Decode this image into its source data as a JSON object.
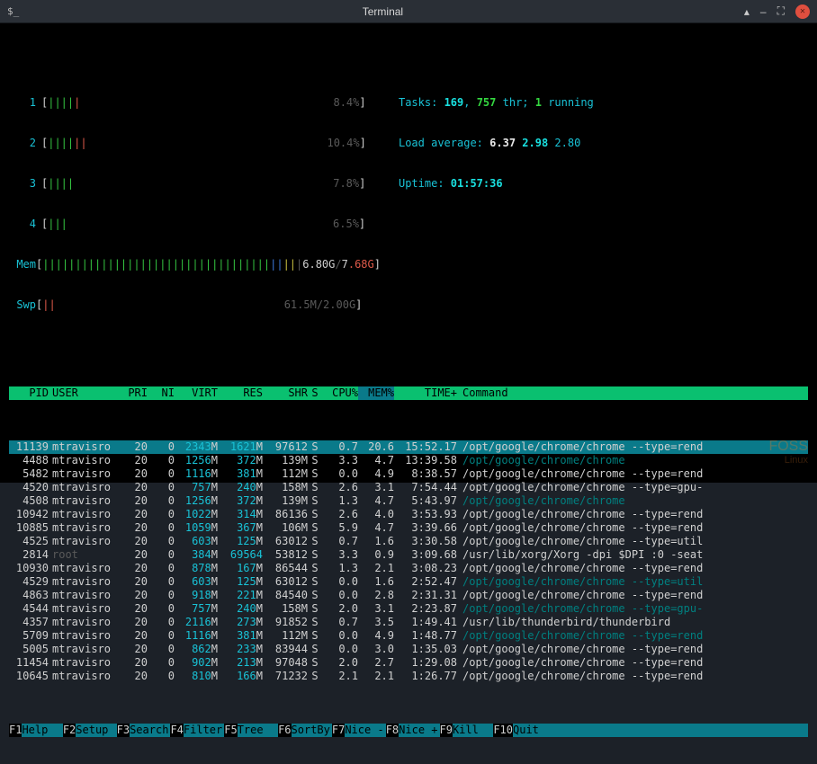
{
  "titlebar": {
    "app_glyph": "$_",
    "title": "Terminal"
  },
  "cpus": [
    {
      "id": "1",
      "pct": "8.4%"
    },
    {
      "id": "2",
      "pct": "10.4%"
    },
    {
      "id": "3",
      "pct": "7.8%"
    },
    {
      "id": "4",
      "pct": "6.5%"
    }
  ],
  "mem": {
    "label": "Mem",
    "used": "6.80G",
    "sep": "/",
    "total_a": "7",
    "total_b": ".68G"
  },
  "swp": {
    "label": "Swp",
    "used": "61.5M",
    "total": "2.00G"
  },
  "tasks": {
    "label": "Tasks: ",
    "procs": "169",
    "sep1": ", ",
    "threads": "757",
    "thr_lbl": " thr; ",
    "running": "1",
    "run_lbl": " running"
  },
  "loadavg": {
    "label": "Load average: ",
    "a": "6.37",
    "b": "2.98",
    "c": "2.80"
  },
  "uptime": {
    "label": "Uptime: ",
    "value": "01:57:36"
  },
  "columns": {
    "pid": "PID",
    "user": "USER",
    "pri": "PRI",
    "ni": "NI",
    "virt": "VIRT",
    "res": "RES",
    "shr": "SHR",
    "s": "S",
    "cpu": "CPU%",
    "mem": "MEM%",
    "time": "TIME+",
    "cmd": "Command"
  },
  "rows": [
    {
      "pid": "11139",
      "user": "mtravisro",
      "pri": "20",
      "ni": "0",
      "virt": "2343M",
      "res": "1621M",
      "shr": "97612",
      "s": "S",
      "cpu": "0.7",
      "mem": "20.6",
      "time": "15:52.17",
      "cmd": "/opt/google/chrome/chrome --type=rend",
      "dim": false,
      "sel": true
    },
    {
      "pid": "4488",
      "user": "mtravisro",
      "pri": "20",
      "ni": "0",
      "virt": "1256M",
      "res": "372M",
      "shr": "139M",
      "s": "S",
      "cpu": "3.3",
      "mem": "4.7",
      "time": "13:39.58",
      "cmd": "/opt/google/chrome/chrome",
      "dim": true
    },
    {
      "pid": "5482",
      "user": "mtravisro",
      "pri": "20",
      "ni": "0",
      "virt": "1116M",
      "res": "381M",
      "shr": "112M",
      "s": "S",
      "cpu": "0.0",
      "mem": "4.9",
      "time": "8:38.57",
      "cmd": "/opt/google/chrome/chrome --type=rend",
      "dim": false
    },
    {
      "pid": "4520",
      "user": "mtravisro",
      "pri": "20",
      "ni": "0",
      "virt": "757M",
      "res": "240M",
      "shr": "158M",
      "s": "S",
      "cpu": "2.6",
      "mem": "3.1",
      "time": "7:54.44",
      "cmd": "/opt/google/chrome/chrome --type=gpu-",
      "dim": false
    },
    {
      "pid": "4508",
      "user": "mtravisro",
      "pri": "20",
      "ni": "0",
      "virt": "1256M",
      "res": "372M",
      "shr": "139M",
      "s": "S",
      "cpu": "1.3",
      "mem": "4.7",
      "time": "5:43.97",
      "cmd": "/opt/google/chrome/chrome",
      "dim": true
    },
    {
      "pid": "10942",
      "user": "mtravisro",
      "pri": "20",
      "ni": "0",
      "virt": "1022M",
      "res": "314M",
      "shr": "86136",
      "s": "S",
      "cpu": "2.6",
      "mem": "4.0",
      "time": "3:53.93",
      "cmd": "/opt/google/chrome/chrome --type=rend",
      "dim": false
    },
    {
      "pid": "10885",
      "user": "mtravisro",
      "pri": "20",
      "ni": "0",
      "virt": "1059M",
      "res": "367M",
      "shr": "106M",
      "s": "S",
      "cpu": "5.9",
      "mem": "4.7",
      "time": "3:39.66",
      "cmd": "/opt/google/chrome/chrome --type=rend",
      "dim": false
    },
    {
      "pid": "4525",
      "user": "mtravisro",
      "pri": "20",
      "ni": "0",
      "virt": "603M",
      "res": "125M",
      "shr": "63012",
      "s": "S",
      "cpu": "0.7",
      "mem": "1.6",
      "time": "3:30.58",
      "cmd": "/opt/google/chrome/chrome --type=util",
      "dim": false
    },
    {
      "pid": "2814",
      "user": "root",
      "pri": "20",
      "ni": "0",
      "virt": "384M",
      "res": "69564",
      "shr": "53812",
      "s": "S",
      "cpu": "3.3",
      "mem": "0.9",
      "time": "3:09.68",
      "cmd": "/usr/lib/xorg/Xorg -dpi $DPI :0 -seat",
      "dim": false,
      "userdim": true
    },
    {
      "pid": "10930",
      "user": "mtravisro",
      "pri": "20",
      "ni": "0",
      "virt": "878M",
      "res": "167M",
      "shr": "86544",
      "s": "S",
      "cpu": "1.3",
      "mem": "2.1",
      "time": "3:08.23",
      "cmd": "/opt/google/chrome/chrome --type=rend",
      "dim": false
    },
    {
      "pid": "4529",
      "user": "mtravisro",
      "pri": "20",
      "ni": "0",
      "virt": "603M",
      "res": "125M",
      "shr": "63012",
      "s": "S",
      "cpu": "0.0",
      "mem": "1.6",
      "time": "2:52.47",
      "cmd": "/opt/google/chrome/chrome --type=util",
      "dim": true
    },
    {
      "pid": "4863",
      "user": "mtravisro",
      "pri": "20",
      "ni": "0",
      "virt": "918M",
      "res": "221M",
      "shr": "84540",
      "s": "S",
      "cpu": "0.0",
      "mem": "2.8",
      "time": "2:31.31",
      "cmd": "/opt/google/chrome/chrome --type=rend",
      "dim": false
    },
    {
      "pid": "4544",
      "user": "mtravisro",
      "pri": "20",
      "ni": "0",
      "virt": "757M",
      "res": "240M",
      "shr": "158M",
      "s": "S",
      "cpu": "2.0",
      "mem": "3.1",
      "time": "2:23.87",
      "cmd": "/opt/google/chrome/chrome --type=gpu-",
      "dim": true
    },
    {
      "pid": "4357",
      "user": "mtravisro",
      "pri": "20",
      "ni": "0",
      "virt": "2116M",
      "res": "273M",
      "shr": "91852",
      "s": "S",
      "cpu": "0.7",
      "mem": "3.5",
      "time": "1:49.41",
      "cmd": "/usr/lib/thunderbird/thunderbird",
      "dim": false
    },
    {
      "pid": "5709",
      "user": "mtravisro",
      "pri": "20",
      "ni": "0",
      "virt": "1116M",
      "res": "381M",
      "shr": "112M",
      "s": "S",
      "cpu": "0.0",
      "mem": "4.9",
      "time": "1:48.77",
      "cmd": "/opt/google/chrome/chrome --type=rend",
      "dim": true
    },
    {
      "pid": "5005",
      "user": "mtravisro",
      "pri": "20",
      "ni": "0",
      "virt": "862M",
      "res": "233M",
      "shr": "83944",
      "s": "S",
      "cpu": "0.0",
      "mem": "3.0",
      "time": "1:35.03",
      "cmd": "/opt/google/chrome/chrome --type=rend",
      "dim": false
    },
    {
      "pid": "11454",
      "user": "mtravisro",
      "pri": "20",
      "ni": "0",
      "virt": "902M",
      "res": "213M",
      "shr": "97048",
      "s": "S",
      "cpu": "2.0",
      "mem": "2.7",
      "time": "1:29.08",
      "cmd": "/opt/google/chrome/chrome --type=rend",
      "dim": false
    },
    {
      "pid": "10645",
      "user": "mtravisro",
      "pri": "20",
      "ni": "0",
      "virt": "810M",
      "res": "166M",
      "shr": "71232",
      "s": "S",
      "cpu": "2.1",
      "mem": "2.1",
      "time": "1:26.77",
      "cmd": "/opt/google/chrome/chrome --type=rend",
      "dim": false
    }
  ],
  "fkeys": [
    {
      "k": "F1",
      "l": "Help"
    },
    {
      "k": "F2",
      "l": "Setup"
    },
    {
      "k": "F3",
      "l": "Search"
    },
    {
      "k": "F4",
      "l": "Filter"
    },
    {
      "k": "F5",
      "l": "Tree"
    },
    {
      "k": "F6",
      "l": "SortBy"
    },
    {
      "k": "F7",
      "l": "Nice -"
    },
    {
      "k": "F8",
      "l": "Nice +"
    },
    {
      "k": "F9",
      "l": "Kill"
    },
    {
      "k": "F10",
      "l": "Quit"
    }
  ],
  "watermark": {
    "a": "FOSS",
    "b": "Linux"
  }
}
